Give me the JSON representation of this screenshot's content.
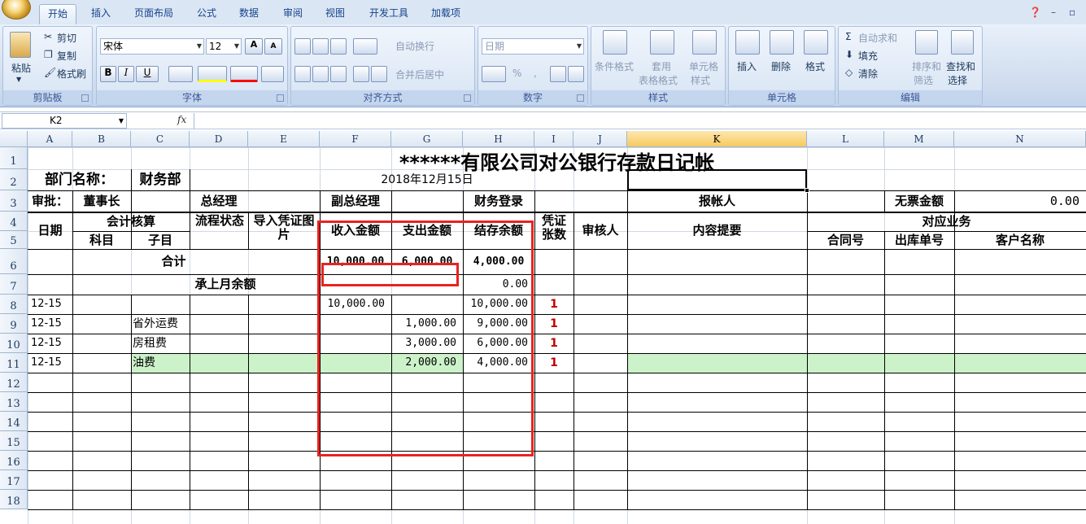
{
  "ribbon_tabs": [
    "开始",
    "插入",
    "页面布局",
    "公式",
    "数据",
    "审阅",
    "视图",
    "开发工具",
    "加载项"
  ],
  "clipboard": {
    "paste": "粘贴",
    "cut": "剪切",
    "copy": "复制",
    "format_painter": "格式刷",
    "label": "剪贴板"
  },
  "font": {
    "name": "宋体",
    "size": "12",
    "label": "字体",
    "bold": "B",
    "italic": "I",
    "underline": "U",
    "inc": "A",
    "dec": "A"
  },
  "alignment": {
    "wrap": "自动换行",
    "merge": "合并后居中",
    "label": "对齐方式"
  },
  "number": {
    "format": "日期",
    "percent": "%",
    "comma": ",",
    "label": "数字"
  },
  "styles": {
    "conditional": "条件格式",
    "table_l1": "套用",
    "table_l2": "表格格式",
    "cell_l1": "单元格",
    "cell_l2": "样式",
    "label": "样式"
  },
  "cells": {
    "insert": "插入",
    "delete": "删除",
    "format": "格式",
    "label": "单元格"
  },
  "editing": {
    "autosum": "自动求和",
    "fill": "填充",
    "clear": "清除",
    "sort_l1": "排序和",
    "sort_l2": "筛选",
    "find_l1": "查找和",
    "find_l2": "选择",
    "label": "编辑"
  },
  "formula_bar": {
    "name_box": "K2",
    "fx": "fx",
    "formula": ""
  },
  "columns": [
    "A",
    "B",
    "C",
    "D",
    "E",
    "F",
    "G",
    "H",
    "I",
    "J",
    "K",
    "L",
    "M",
    "N"
  ],
  "rows": [
    "1",
    "2",
    "3",
    "4",
    "5",
    "6",
    "7",
    "8",
    "9",
    "10",
    "11",
    "12",
    "13",
    "14",
    "15",
    "16",
    "17",
    "18"
  ],
  "sheet": {
    "title": "******有限公司对公银行存款日记帐",
    "dept_label": "部门名称：",
    "dept_value": "财务部",
    "date": "2018年12月15日",
    "approve": "审批：",
    "chairman": "董事长",
    "gm": "总经理",
    "vgm": "副总经理",
    "finance_login": "财务登录",
    "reporter": "报帐人",
    "no_ticket": "无票金额",
    "no_ticket_value": "0.00",
    "h_date": "日期",
    "h_account": "会计核算",
    "h_subject": "科目",
    "h_subitem": "子目",
    "h_flow": "流程状态",
    "h_import": "导入凭证图片",
    "h_income": "收入金额",
    "h_expense": "支出金额",
    "h_balance": "结存余额",
    "h_voucher": "凭证张数",
    "h_reviewer": "审核人",
    "h_summary": "内容提要",
    "h_business": "对应业务",
    "h_contract": "合同号",
    "h_outbound": "出库单号",
    "h_customer": "客户名称",
    "total_label": "合计",
    "total_income": "10,000.00",
    "total_expense": "6,000.00",
    "total_balance": "4,000.00",
    "carry_label": "承上月余额",
    "carry_balance": "0.00",
    "entries": [
      {
        "date": "12-15",
        "sub": "",
        "income": "10,000.00",
        "expense": "",
        "balance": "10,000.00",
        "count": "1"
      },
      {
        "date": "12-15",
        "sub": "省外运费",
        "income": "",
        "expense": "1,000.00",
        "balance": "9,000.00",
        "count": "1"
      },
      {
        "date": "12-15",
        "sub": "房租费",
        "income": "",
        "expense": "3,000.00",
        "balance": "6,000.00",
        "count": "1"
      },
      {
        "date": "12-15",
        "sub": "油费",
        "income": "",
        "expense": "2,000.00",
        "balance": "4,000.00",
        "count": "1"
      }
    ]
  },
  "colors": {
    "highlight_box": "#e8231f",
    "green_row": "#ccf2c9",
    "selected_header": "#f7c95e"
  }
}
